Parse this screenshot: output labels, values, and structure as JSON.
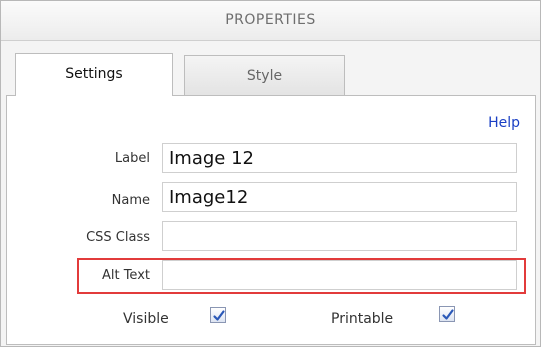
{
  "header": {
    "title": "PROPERTIES"
  },
  "tabs": [
    {
      "label": "Settings",
      "active": true
    },
    {
      "label": "Style",
      "active": false
    }
  ],
  "help_label": "Help",
  "fields": {
    "label": {
      "label": "Label",
      "value": "Image 12"
    },
    "name": {
      "label": "Name",
      "value": "Image12"
    },
    "css_class": {
      "label": "CSS Class",
      "value": ""
    },
    "alt_text": {
      "label": "Alt Text",
      "value": ""
    }
  },
  "checkboxes": {
    "visible": {
      "label": "Visible",
      "checked": true
    },
    "printable": {
      "label": "Printable",
      "checked": true
    }
  },
  "colors": {
    "highlight": "#e23b3b",
    "link": "#1a3fc4",
    "check": "#2a58b8"
  }
}
